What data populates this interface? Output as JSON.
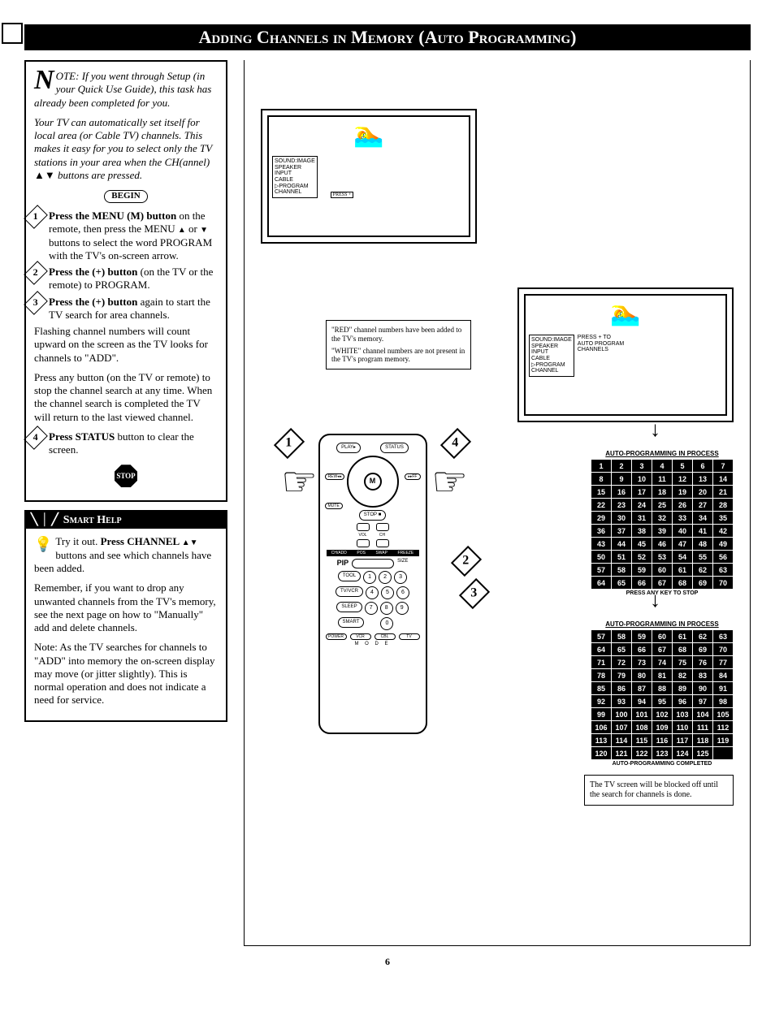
{
  "header": "Adding Channels in Memory (Auto Programming)",
  "note": {
    "para1_pre": "OTE: If you went through Setup (in your Quick Use Guide), this task has already been completed for you.",
    "para2": "Your TV can automatically set itself for local area (or Cable TV) channels. This makes it easy for you to select only the TV stations in your area when the CH(annel) ▲▼ buttons are pressed.",
    "begin": "BEGIN",
    "step1": "Press the MENU (M) button on the remote, then press the MENU ▲ or ▼ buttons to select the word PROGRAM with the TV's on-screen arrow.",
    "step1_bold": "Press the MENU (M) button",
    "step2": "Press the (+) button (on the TV or the remote) to PROGRAM.",
    "step2_bold": "Press the (+) button",
    "step3": "Press the (+) button again to start the TV search for area channels.",
    "step3_bold": "Press the (+) button",
    "para3": "Flashing channel numbers will count upward on the screen as the TV looks for channels to \"ADD\".",
    "para4": "Press any button (on the TV or remote) to stop the channel search at any time. When the channel search is completed the TV will return to the last viewed channel.",
    "step4": "Press STATUS button to clear the screen.",
    "step4_bold": "Press STATUS",
    "stop": "STOP"
  },
  "smart": {
    "title": "Smart Help",
    "p1": "Try it out. Press CHANNEL ▲▼ buttons and see which channels have been added.",
    "p1_bold": "Press CHANNEL ▲▼",
    "p2": "Remember, if you want to drop any unwanted channels from the TV's memory, see the next page on how to \"Manually\" add and delete channels.",
    "p3": "Note: As the TV searches for channels to \"ADD\" into memory the on-screen display may move (or jitter slightly). This is normal operation and does not indicate a need for service."
  },
  "tv_menu": {
    "items": [
      "SOUND:IMAGE",
      "SPEAKER",
      "INPUT",
      "CABLE",
      "PROGRAM",
      "CHANNEL"
    ],
    "press": "PRESS +",
    "press2_a": "PRESS + TO",
    "press2_b": "AUTO PROGRAM",
    "press2_c": "CHANNELS"
  },
  "msg": {
    "l1": "\"RED\" channel numbers have been added to the TV's memory.",
    "l2": "\"WHITE\" channel numbers are not present in the TV's program memory."
  },
  "grid1": {
    "title": "AUTO-PROGRAMMING IN PROCESS",
    "rows": [
      [
        1,
        2,
        3,
        4,
        5,
        6,
        7
      ],
      [
        8,
        9,
        10,
        11,
        12,
        13,
        14
      ],
      [
        15,
        16,
        17,
        18,
        19,
        20,
        21
      ],
      [
        22,
        23,
        24,
        25,
        26,
        27,
        28
      ],
      [
        29,
        30,
        31,
        32,
        33,
        34,
        35
      ],
      [
        36,
        37,
        38,
        39,
        40,
        41,
        42
      ],
      [
        43,
        44,
        45,
        46,
        47,
        48,
        49
      ],
      [
        50,
        51,
        52,
        53,
        54,
        55,
        56
      ],
      [
        57,
        58,
        59,
        60,
        61,
        62,
        63
      ],
      [
        64,
        65,
        66,
        67,
        68,
        69,
        70
      ]
    ],
    "sub": "PRESS ANY KEY TO STOP"
  },
  "grid2": {
    "title": "AUTO-PROGRAMMING IN PROCESS",
    "rows": [
      [
        57,
        58,
        59,
        60,
        61,
        62,
        63
      ],
      [
        64,
        65,
        66,
        67,
        68,
        69,
        70
      ],
      [
        71,
        72,
        73,
        74,
        75,
        76,
        77
      ],
      [
        78,
        79,
        80,
        81,
        82,
        83,
        84
      ],
      [
        85,
        86,
        87,
        88,
        89,
        90,
        91
      ],
      [
        92,
        93,
        94,
        95,
        96,
        97,
        98
      ],
      [
        99,
        100,
        101,
        102,
        103,
        104,
        105
      ],
      [
        106,
        107,
        108,
        109,
        110,
        111,
        112
      ],
      [
        113,
        114,
        115,
        116,
        117,
        118,
        119
      ],
      [
        120,
        121,
        122,
        123,
        124,
        125,
        ""
      ]
    ],
    "sub": "AUTO-PROGRAMMING COMPLETED"
  },
  "final_note": "The TV screen will be blocked off until the search for channels is done.",
  "remote": {
    "play": "PLAY▸",
    "status": "STATUS",
    "rew": "REW◂◂",
    "ff": "▸▸FF",
    "mute": "MUTE",
    "stop": "STOP ■",
    "strip": [
      "CH/ADD",
      "POS",
      "SWAP",
      "FREEZE"
    ],
    "pip": "PIP",
    "size": "SIZE",
    "row1": [
      "TOOL",
      "1",
      "2",
      "3"
    ],
    "row2": [
      "TV/VCR",
      "4",
      "5",
      "6"
    ],
    "row3": [
      "SLEEP",
      "7",
      "8",
      "9"
    ],
    "row4": [
      "SMART",
      "",
      "0",
      ""
    ],
    "bot": [
      "POWER",
      "VCR",
      "CBL",
      "TV"
    ],
    "mode": "M  O  D  E"
  },
  "page": "6"
}
